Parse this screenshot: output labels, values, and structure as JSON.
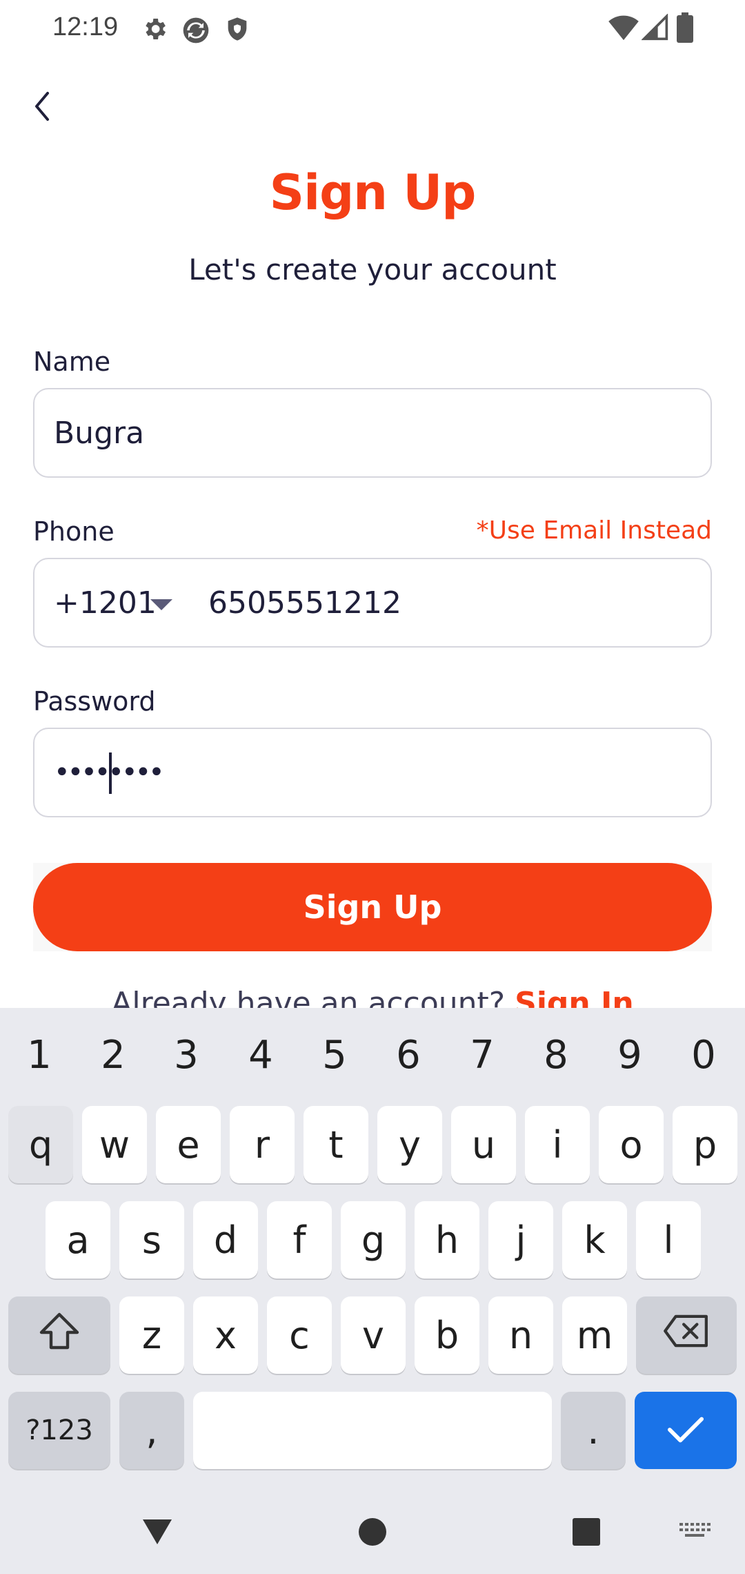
{
  "status_bar": {
    "time": "12:19",
    "left_icons": [
      "gear-icon",
      "sync-icon",
      "shield-icon"
    ],
    "right_icons": [
      "wifi-icon",
      "cellular-signal-icon",
      "battery-icon"
    ]
  },
  "header": {
    "back_icon": "chevron-left-icon",
    "title": "Sign Up",
    "subtitle": "Let's create your account"
  },
  "form": {
    "name": {
      "label": "Name",
      "value": "Bugra"
    },
    "phone": {
      "label": "Phone",
      "alt_link": "*Use Email Instead",
      "country_code": "+1201",
      "value": "6505551212"
    },
    "password": {
      "label": "Password",
      "value": "••••••••"
    },
    "submit_label": "Sign Up",
    "footer_text": "Already have an account?",
    "footer_link": "Sign In"
  },
  "colors": {
    "accent": "#f43f16",
    "text": "#1f1f3a",
    "keyboard_bg": "#e9eaef",
    "enter_key": "#1a73e8"
  },
  "keyboard": {
    "numbers": [
      "1",
      "2",
      "3",
      "4",
      "5",
      "6",
      "7",
      "8",
      "9",
      "0"
    ],
    "row1": [
      "q",
      "w",
      "e",
      "r",
      "t",
      "y",
      "u",
      "i",
      "o",
      "p"
    ],
    "row2": [
      "a",
      "s",
      "d",
      "f",
      "g",
      "h",
      "j",
      "k",
      "l"
    ],
    "row3": [
      "z",
      "x",
      "c",
      "v",
      "b",
      "n",
      "m"
    ],
    "symbols_key": "?123",
    "comma_key": ",",
    "period_key": ".",
    "shift_icon": "shift-icon",
    "backspace_icon": "backspace-icon",
    "enter_icon": "checkmark-icon"
  },
  "nav_bar": {
    "icons": [
      "back-triangle-icon",
      "home-circle-icon",
      "recents-square-icon",
      "keyboard-switch-icon"
    ]
  }
}
